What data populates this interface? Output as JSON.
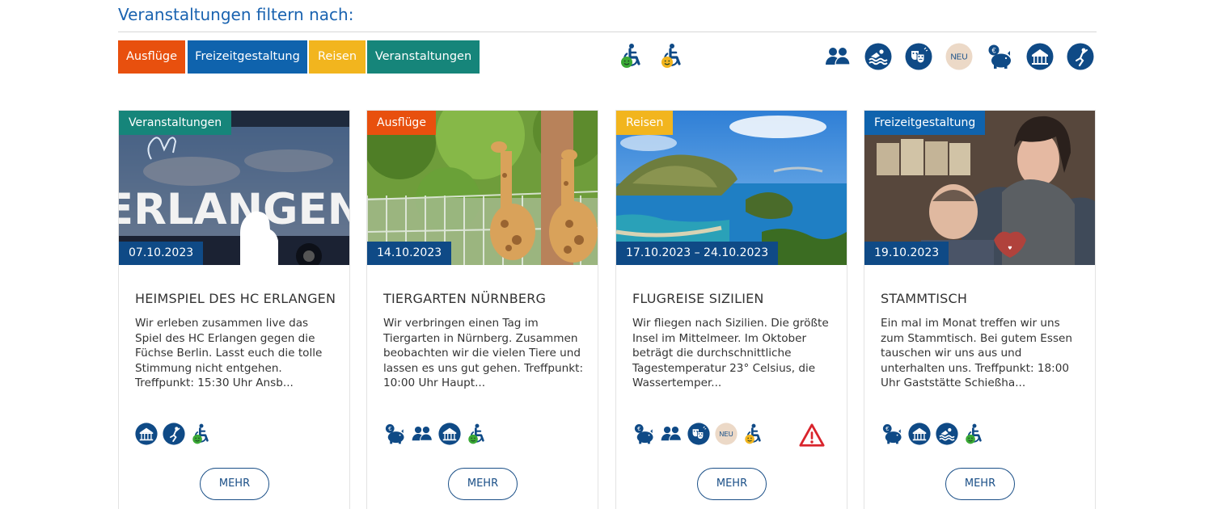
{
  "filter": {
    "title": "Veranstaltungen filtern nach:",
    "buttons": [
      {
        "label": "Ausflüge",
        "color": "#e8500e"
      },
      {
        "label": "Freizeitgestaltung",
        "color": "#0f63ad"
      },
      {
        "label": "Reisen",
        "color": "#f2b51e"
      },
      {
        "label": "Veranstaltungen",
        "color": "#16857a"
      }
    ],
    "accessibility_icons": [
      "wheelchair-green-icon",
      "wheelchair-orange-icon"
    ],
    "category_icons": [
      "group-icon",
      "swimming-icon",
      "theater-masks-icon",
      "new-badge-icon",
      "piggy-bank-euro-icon",
      "carousel-icon",
      "sports-icon"
    ],
    "new_badge": "NEU"
  },
  "colors": {
    "icon_blue": "#0f4a86",
    "date_bg": "#0f4a86",
    "new_badge_bg": "#ecd9c7",
    "warning_red": "#d9242c"
  },
  "cards": [
    {
      "category": "Veranstaltungen",
      "category_color": "#16857a",
      "date": "07.10.2023",
      "title": "HEIMSPIEL DES HC ERLANGEN",
      "text": "Wir erleben zusammen live das Spiel des HC Erlangen gegen die Füchse Berlin. Lasst euch die tolle Stimmung nicht entgehen. Treffpunkt: 15:30 Uhr Ansb...",
      "photo_text": "ERLANGEN",
      "icons": [
        "carousel-icon",
        "sports-icon",
        "wheelchair-green-icon"
      ],
      "button": "MEHR"
    },
    {
      "category": "Ausflüge",
      "category_color": "#e8500e",
      "date": "14.10.2023",
      "title": "TIERGARTEN NÜRNBERG",
      "text": "Wir verbringen einen Tag im Tiergarten in Nürnberg. Zusammen beobachten wir die vielen Tiere und lassen es uns gut gehen. Treffpunkt: 10:00 Uhr Haupt...",
      "icons": [
        "piggy-bank-euro-icon",
        "group-icon",
        "carousel-icon",
        "wheelchair-green-icon"
      ],
      "button": "MEHR"
    },
    {
      "category": "Reisen",
      "category_color": "#f2b51e",
      "date": "17.10.2023 – 24.10.2023",
      "title": "FLUGREISE SIZILIEN",
      "text": "Wir fliegen nach Sizilien. Die größte Insel im Mittelmeer. Im Oktober beträgt die durchschnittliche Tagestemperatur 23° Celsius, die Wassertemper...",
      "icons": [
        "piggy-bank-euro-icon",
        "group-icon",
        "theater-masks-icon",
        "new-badge-icon",
        "wheelchair-orange-icon",
        "warning-icon"
      ],
      "button": "MEHR"
    },
    {
      "category": "Freizeitgestaltung",
      "category_color": "#0f63ad",
      "date": "19.10.2023",
      "title": "STAMMTISCH",
      "text": "Ein mal im Monat treffen wir uns zum Stammtisch. Bei gutem Essen tauschen wir uns aus und unterhalten uns. Treffpunkt: 18:00 Uhr Gaststätte Schießha...",
      "icons": [
        "piggy-bank-euro-icon",
        "carousel-icon",
        "swimming-icon",
        "wheelchair-green-icon"
      ],
      "button": "MEHR"
    }
  ]
}
